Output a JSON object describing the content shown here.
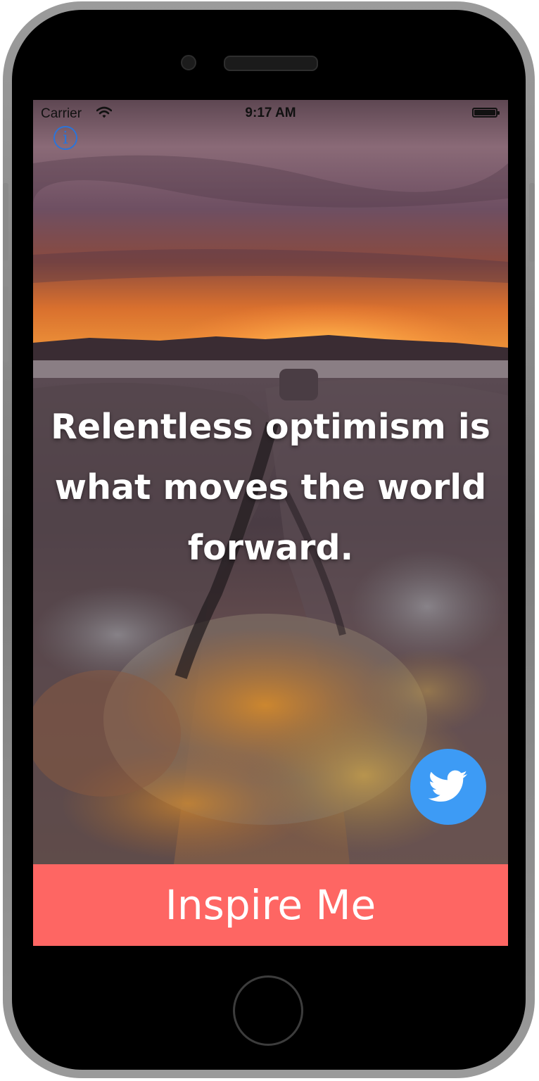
{
  "status_bar": {
    "carrier": "Carrier",
    "time": "9:17 AM",
    "wifi_icon": "wifi-icon",
    "battery_icon": "battery-full-icon"
  },
  "info_button": {
    "icon": "info-icon",
    "glyph": "i",
    "color": "#2b74d9"
  },
  "quote": {
    "text": "Relentless optimism is what moves the world forward."
  },
  "twitter_button": {
    "icon": "twitter-bird-icon",
    "color": "#3d9bf5"
  },
  "inspire_button": {
    "label": "Inspire Me",
    "color": "#fe6663"
  }
}
